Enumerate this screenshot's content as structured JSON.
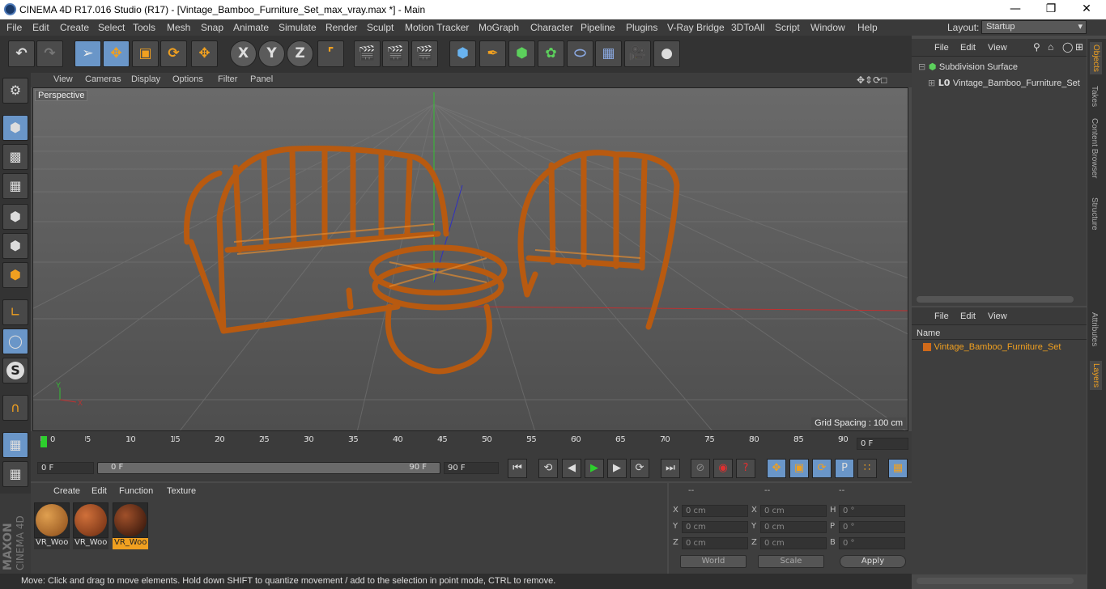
{
  "window": {
    "title": "CINEMA 4D R17.016 Studio (R17) - [Vintage_Bamboo_Furniture_Set_max_vray.max *] - Main"
  },
  "menu": [
    "File",
    "Edit",
    "Create",
    "Select",
    "Tools",
    "Mesh",
    "Snap",
    "Animate",
    "Simulate",
    "Render",
    "Sculpt",
    "Motion Tracker",
    "MoGraph",
    "Character",
    "Pipeline",
    "Plugins",
    "V-Ray Bridge",
    "3DToAll",
    "Script",
    "Window",
    "Help"
  ],
  "layout": {
    "label": "Layout:",
    "value": "Startup"
  },
  "toolbar": {
    "x": "X",
    "y": "Y",
    "z": "Z"
  },
  "viewport": {
    "menu": [
      "View",
      "Cameras",
      "Display",
      "Options",
      "Filter",
      "Panel"
    ],
    "label": "Perspective",
    "grid_spacing": "Grid Spacing : 100 cm",
    "axis_x": "X",
    "axis_y": "Y"
  },
  "timeline": {
    "ticks": [
      "0",
      "5",
      "10",
      "15",
      "20",
      "25",
      "30",
      "35",
      "40",
      "45",
      "50",
      "55",
      "60",
      "65",
      "70",
      "75",
      "80",
      "85",
      "90"
    ],
    "current": "0 F"
  },
  "transport": {
    "start": "0 F",
    "range_start": "0 F",
    "range_end": "90 F",
    "end": "90 F"
  },
  "materials": {
    "menu": [
      "Create",
      "Edit",
      "Function",
      "Texture"
    ],
    "items": [
      {
        "name": "VR_Woo",
        "color": "#c07a30"
      },
      {
        "name": "VR_Woo",
        "color": "#a85020"
      },
      {
        "name": "VR_Woo",
        "color": "#7a3a18"
      }
    ]
  },
  "coords": {
    "headers": [
      "--",
      "--",
      "--"
    ],
    "rows": [
      {
        "a": "X",
        "av": "0 cm",
        "b": "X",
        "bv": "0 cm",
        "c": "H",
        "cv": "0 °"
      },
      {
        "a": "Y",
        "av": "0 cm",
        "b": "Y",
        "bv": "0 cm",
        "c": "P",
        "cv": "0 °"
      },
      {
        "a": "Z",
        "av": "0 cm",
        "b": "Z",
        "bv": "0 cm",
        "c": "B",
        "cv": "0 °"
      }
    ],
    "world": "World",
    "scale": "Scale",
    "apply": "Apply"
  },
  "objects": {
    "menu": [
      "File",
      "Edit",
      "View"
    ],
    "items": [
      "Subdivision Surface",
      "Vintage_Bamboo_Furniture_Set"
    ]
  },
  "layers": {
    "menu": [
      "File",
      "Edit",
      "View"
    ],
    "header": "Name",
    "items": [
      "Vintage_Bamboo_Furniture_Set"
    ]
  },
  "right_tabs": [
    "Objects",
    "Takes",
    "Content Browser",
    "Structure",
    "Attributes",
    "Layers"
  ],
  "brand": {
    "maxon": "MAXON",
    "c4d": "CINEMA 4D"
  },
  "status": "Move: Click and drag to move elements. Hold down SHIFT to quantize movement / add to the selection in point mode, CTRL to remove."
}
